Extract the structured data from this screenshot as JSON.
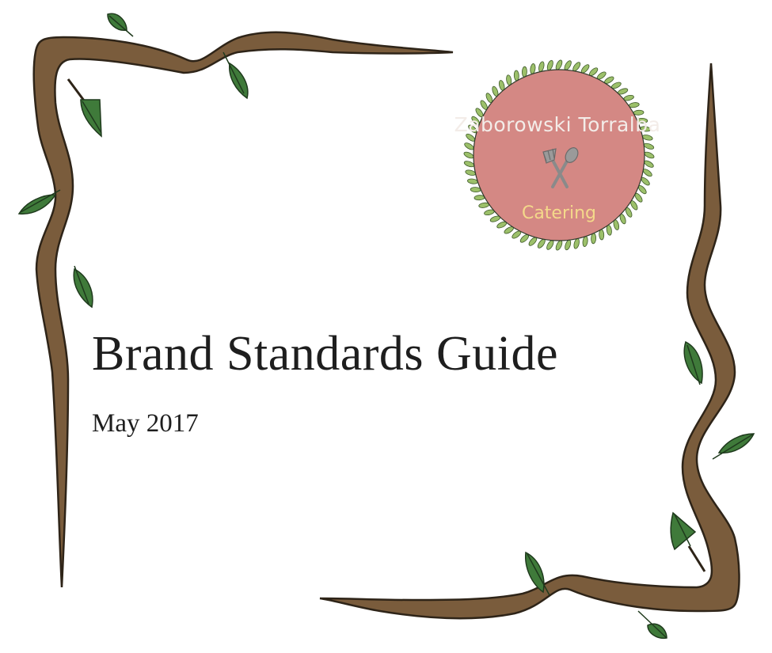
{
  "document": {
    "title": "Brand Standards Guide",
    "date": "May 2017"
  },
  "logo": {
    "name": "Zaborowski Torralba",
    "tagline": "Catering",
    "icon": "fork-and-spoon-icon",
    "fill_color": "#d48884",
    "name_color": "#f3ece8",
    "tagline_color": "#f4d98a",
    "wreath_color": "#9cc06a"
  },
  "colors": {
    "branch": "#7a5c3c",
    "branch_outline": "#2e2418",
    "leaf": "#3f7a3a",
    "leaf_dark": "#1f3a1d"
  }
}
